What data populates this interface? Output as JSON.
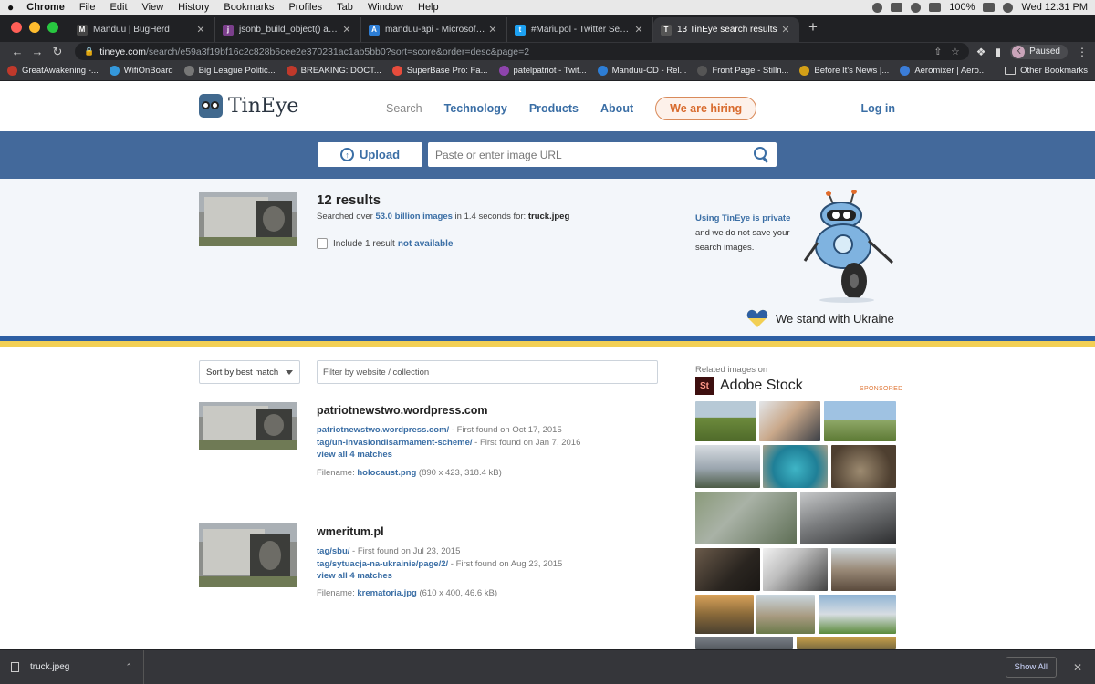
{
  "menubar": {
    "apple": "",
    "items": [
      "Chrome",
      "File",
      "Edit",
      "View",
      "History",
      "Bookmarks",
      "Profiles",
      "Tab",
      "Window",
      "Help"
    ],
    "battery": "100%",
    "clock": "Wed 12:31 PM"
  },
  "tabs": [
    {
      "title": "Manduu | BugHerd",
      "fav_color": "#444"
    },
    {
      "title": "jsonb_build_object() and json_",
      "fav_color": "#7b3f8c"
    },
    {
      "title": "manduu-api - Microsoft Azure",
      "fav_color": "#2d7ed6"
    },
    {
      "title": "#Mariupol - Twitter Search / Tw",
      "fav_color": "#1da1f2"
    },
    {
      "title": "13 TinEye search results",
      "fav_color": "#555"
    }
  ],
  "toolbar": {
    "url_host": "tineye.com",
    "url_path": "/search/e59a3f19bf16c2c828b6cee2e370231ac1ab5bb0?sort=score&order=desc&page=2",
    "profile_initial": "K",
    "profile_status": "Paused"
  },
  "bookmarks": [
    {
      "label": "GreatAwakening -...",
      "color": "#c0392b"
    },
    {
      "label": "WifiOnBoard",
      "color": "#3498db"
    },
    {
      "label": "Big League Politic...",
      "color": "#777"
    },
    {
      "label": "BREAKING: DOCT...",
      "color": "#c0392b"
    },
    {
      "label": "SuperBase Pro: Fa...",
      "color": "#e74c3c"
    },
    {
      "label": "patelpatriot - Twit...",
      "color": "#8e44ad"
    },
    {
      "label": "Manduu-CD - Rel...",
      "color": "#2d7ed6"
    },
    {
      "label": "Front Page - Stilln...",
      "color": "#555"
    },
    {
      "label": "Before It's News |...",
      "color": "#d4a017"
    },
    {
      "label": "Aeromixer | Aero...",
      "color": "#3b7dd8"
    }
  ],
  "bookmarks_other": "Other Bookmarks",
  "header": {
    "logo_text": "TinEye",
    "nav": [
      "Search",
      "Technology",
      "Products",
      "About"
    ],
    "hiring": "We are hiring",
    "login": "Log in"
  },
  "search": {
    "upload_label": "Upload",
    "url_placeholder": "Paste or enter image URL"
  },
  "summary": {
    "count": "12 results",
    "meta_pre": "Searched over ",
    "meta_link": "53.0 billion images",
    "meta_mid": " in 1.4 seconds for: ",
    "meta_file": "truck.jpeg",
    "include_pre": "Include 1 result ",
    "include_link": "not available",
    "privacy_link": "Using TinEye is private",
    "privacy_text": "and we do not save your search images.",
    "ukraine": "We stand with Ukraine"
  },
  "controls": {
    "sort_label": "Sort by best match",
    "filter_placeholder": "Filter by website / collection"
  },
  "results": [
    {
      "domain": "patriotnewstwo.wordpress.com",
      "matches": [
        {
          "link": "patriotnewstwo.wordpress.com/",
          "found": " - First found on Oct 17, 2015"
        },
        {
          "link": "tag/un-invasiondisarmament-scheme/",
          "found": " - First found on Jan 7, 2016"
        }
      ],
      "view_all": "view all 4 matches",
      "filename_label": "Filename: ",
      "filename": "holocaust.png",
      "filename_meta": " (890 x 423, 318.4 kB)"
    },
    {
      "domain": "wmeritum.pl",
      "matches": [
        {
          "link": "tag/sbu/",
          "found": " - First found on Jul 23, 2015"
        },
        {
          "link": "tag/sytuacja-na-ukrainie/page/2/",
          "found": " - First found on Aug 23, 2015"
        }
      ],
      "view_all": "view all 4 matches",
      "filename_label": "Filename: ",
      "filename": "krematoria.jpg",
      "filename_meta": " (610 x 400, 46.6 kB)"
    }
  ],
  "sidebar": {
    "related_label": "Related images on",
    "stock_mark": "St",
    "stock_name": "Adobe Stock",
    "sponsored": "SPONSORED"
  },
  "download": {
    "file": "truck.jpeg",
    "show_all": "Show All"
  },
  "colors": {
    "accent": "#3a6ea5",
    "band": "#43699b",
    "hiring": "#d86b2e",
    "ukraine_blue": "#2d5fa3",
    "ukraine_yellow": "#f2cf54"
  }
}
